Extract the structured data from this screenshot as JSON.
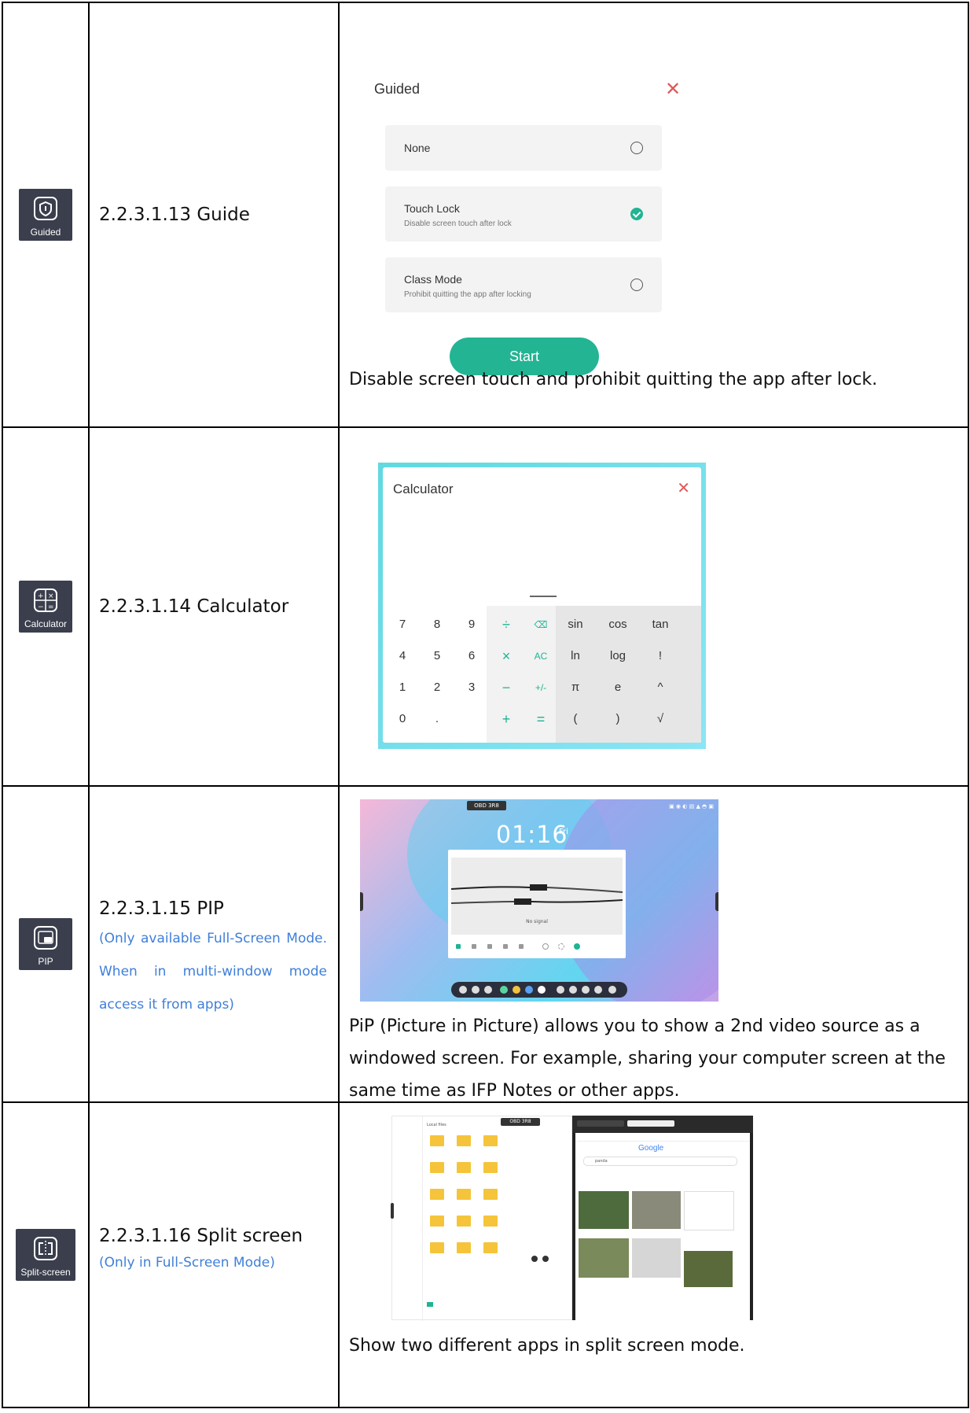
{
  "rows": [
    {
      "icon_label": "Guided",
      "title": "2.2.3.1.13 Guide",
      "note": "",
      "guided_ui": {
        "title": "Guided",
        "options": [
          {
            "name": "None",
            "sub": ""
          },
          {
            "name": "Touch Lock",
            "sub": "Disable screen touch after lock"
          },
          {
            "name": "Class Mode",
            "sub": "Prohibit quitting the app after locking"
          }
        ],
        "selected": "Touch Lock",
        "start_label": "Start"
      },
      "description": "Disable screen touch and prohibit quitting the app after lock."
    },
    {
      "icon_label": "Calculator",
      "title": "2.2.3.1.14 Calculator",
      "calculator_ui": {
        "title": "Calculator",
        "keys": [
          [
            "7",
            "8",
            "9",
            "÷",
            "⌫",
            "sin",
            "cos",
            "tan"
          ],
          [
            "4",
            "5",
            "6",
            "×",
            "AC",
            "ln",
            "log",
            "!"
          ],
          [
            "1",
            "2",
            "3",
            "−",
            "+/-",
            "π",
            "e",
            "^"
          ],
          [
            "0",
            ".",
            "",
            "+",
            "=",
            "(",
            ")",
            "√"
          ]
        ]
      }
    },
    {
      "icon_label": "PIP",
      "title": "2.2.3.1.15 PIP",
      "note": "(Only available Full-Screen Mode. When in multi-window mode access it from apps)",
      "pip_ui": {
        "tag": "OBD 3R8",
        "time": "01:16",
        "date": "Fri",
        "window_text": "No signal"
      },
      "description": "PiP (Picture in Picture) allows you to show a 2nd video source as a windowed screen. For example, sharing your computer screen at the same time as IFP Notes or other apps."
    },
    {
      "icon_label": "Split-screen",
      "title": "2.2.3.1.16 Split screen",
      "note": "(Only in Full-Screen Mode)",
      "split_ui": {
        "tag": "OBD 3R8",
        "left_header": "Local files",
        "browser_logo": "Google",
        "search_query": "panda"
      },
      "description": "Show two different apps in split screen mode."
    }
  ]
}
